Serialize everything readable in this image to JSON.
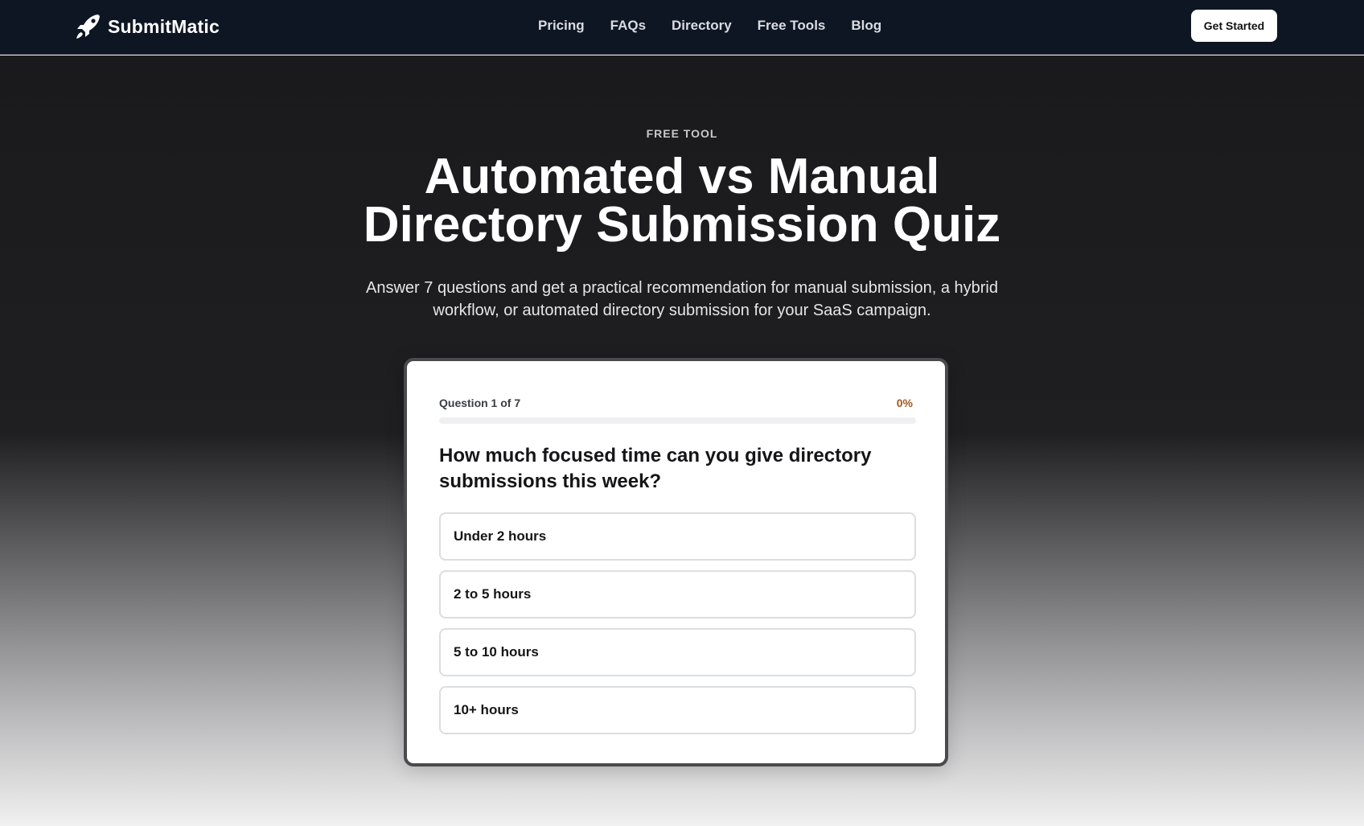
{
  "nav": {
    "logo_text": "SubmitMatic",
    "links": [
      "Pricing",
      "FAQs",
      "Directory",
      "Free Tools",
      "Blog"
    ],
    "cta_label": "Get Started"
  },
  "hero": {
    "eyebrow": "FREE TOOL",
    "title_line1": "Automated vs Manual",
    "title_line2": "Directory Submission Quiz",
    "subtitle": "Answer 7 questions and get a practical recommendation for manual submission, a hybrid workflow, or automated directory submission for your SaaS campaign."
  },
  "quiz": {
    "progress_label": "Question 1 of 7",
    "progress_percent_text": "0%",
    "progress_fraction": 0,
    "question": "How much focused time can you give directory submissions this week?",
    "options": [
      "Under 2 hours",
      "2 to 5 hours",
      "5 to 10 hours",
      "10+ hours"
    ]
  },
  "colors": {
    "nav_bg": "#0f1623",
    "accent": "#a3561d",
    "card_bg": "#ffffff"
  }
}
